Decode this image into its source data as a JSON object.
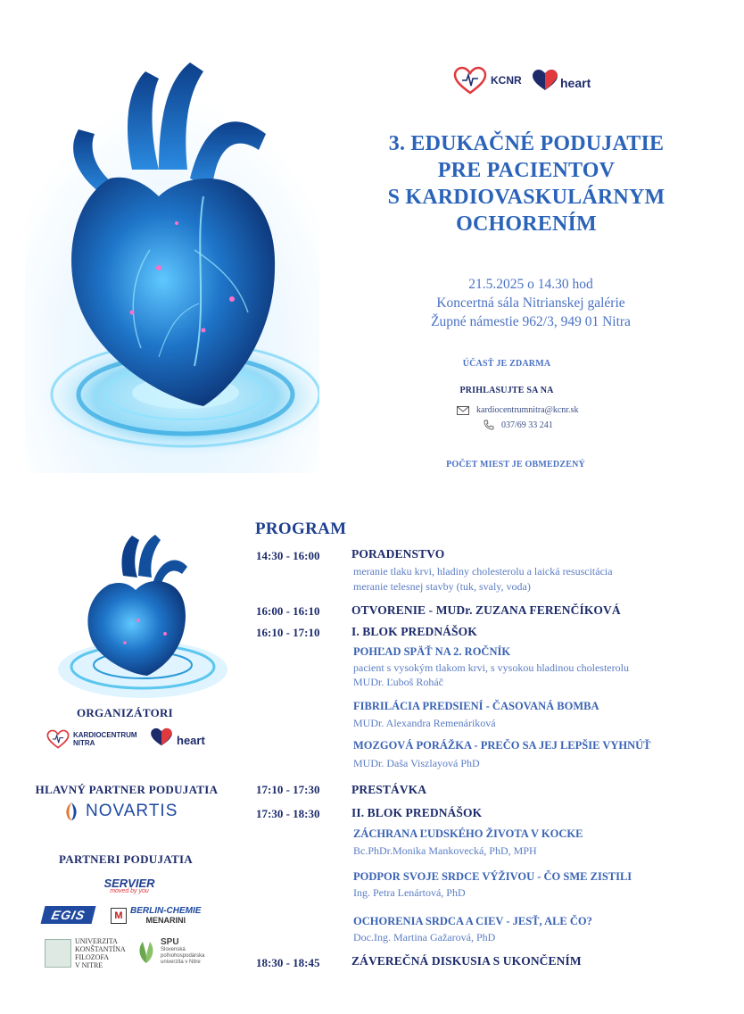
{
  "logos": {
    "kcnr_text": "KCNR",
    "heart_text": "heart"
  },
  "title": {
    "line1": "3. EDUKAČNÉ  PODUJATIE",
    "line2": "PRE PACIENTOV",
    "line3": "S KARDIOVASKULÁRNYM",
    "line4": "OCHORENÍM"
  },
  "event": {
    "datetime": "21.5.2025 o 14.30 hod",
    "venue": "Koncertná sála Nitrianskej galérie",
    "address": "Župné námestie 962/3, 949 01 Nitra"
  },
  "info": {
    "free": "ÚČASŤ JE ZDARMA",
    "register": "PRIHLASUJTE SA NA",
    "email": "kardiocentrumnitra@kcnr.sk",
    "phone": "037/69 33 241",
    "limited": "POČET MIEST JE OBMEDZENÝ"
  },
  "sidebar": {
    "organizers_title": "ORGANIZÁTORI",
    "org_kcnr_line1": "KARDIOCENTRUM",
    "org_kcnr_line2": "NITRA",
    "org_heart": "heart",
    "main_partner_title": "HLAVNÝ PARTNER PODUJATIA",
    "novartis": "NOVARTIS",
    "partners_title": "PARTNERI PODUJATIA",
    "servier": "SERVIER",
    "servier_tag": "moved by you",
    "egis": "EGIS",
    "berlin_line1": "BERLIN-CHEMIE",
    "berlin_line2": "MENARINI",
    "ukf_line1": "UNIVERZITA",
    "ukf_line2": "KONŠTANTÍNA",
    "ukf_line3": "FILOZOFA",
    "ukf_line4": "V NITRE",
    "spu_name": "SPU",
    "spu_sub1": "Slovenská",
    "spu_sub2": "poľnohospodárska",
    "spu_sub3": "univerzita v Nitre"
  },
  "program": {
    "title": "PROGRAM",
    "items": [
      {
        "time": "14:30 - 16:00",
        "head": "PORADENSTVO"
      },
      {
        "time": "16:00 - 16:10",
        "head": "OTVORENIE - MUDr. ZUZANA FERENČÍKOVÁ"
      },
      {
        "time": "16:10 - 17:10",
        "head": "I. BLOK PREDNÁŠOK"
      },
      {
        "time": "17:10 - 17:30",
        "head": "PRESTÁVKA"
      },
      {
        "time": "17:30 - 18:30",
        "head": "II. BLOK PREDNÁŠOK"
      },
      {
        "time": "18:30 - 18:45",
        "head": "ZÁVEREČNÁ DISKUSIA S UKONČENÍM"
      }
    ],
    "poradenstvo_desc1": "meranie tlaku krvi, hladiny cholesterolu a laická resuscitácia",
    "poradenstvo_desc2": "meranie telesnej stavby (tuk, svaly, voda)",
    "talks": [
      {
        "title": "POHĽAD SPÄŤ NA 2. ROČNÍK",
        "desc": "pacient s vysokým tlakom krvi, s vysokou hladinou cholesterolu",
        "speaker": "MUDr. Ľuboš Roháč"
      },
      {
        "title": "FIBRILÁCIA PREDSIENÍ - ČASOVANÁ BOMBA",
        "speaker": "MUDr. Alexandra Remenáriková"
      },
      {
        "title": "MOZGOVÁ PORÁŽKA - PREČO SA JEJ LEPŠIE VYHNÚŤ",
        "speaker": "MUDr. Daša Viszlayová PhD"
      },
      {
        "title": "ZÁCHRANA ĽUDSKÉHO ŽIVOTA V KOCKE",
        "speaker": "Bc.PhDr.Monika Mankovecká, PhD, MPH"
      },
      {
        "title": "PODPOR SVOJE SRDCE VÝŽIVOU - ČO SME ZISTILI",
        "speaker": "Ing. Petra Lenártová, PhD"
      },
      {
        "title": "OCHORENIA SRDCA A CIEV - JESŤ, ALE ČO?",
        "speaker": "Doc.Ing. Martina Gažarová, PhD"
      }
    ]
  }
}
